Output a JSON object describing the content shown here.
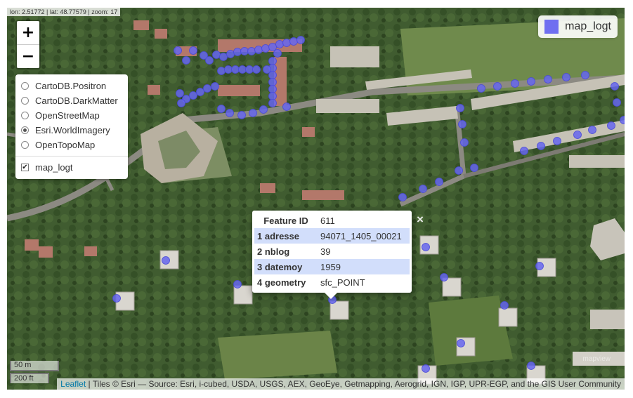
{
  "map": {
    "coord_readout": "lon: 2.51772 | lat: 48.77579 | zoom: 17",
    "zoom_in": "+",
    "zoom_out": "−",
    "basemaps": [
      {
        "label": "CartoDB.Positron",
        "selected": false
      },
      {
        "label": "CartoDB.DarkMatter",
        "selected": false
      },
      {
        "label": "OpenStreetMap",
        "selected": false
      },
      {
        "label": "Esri.WorldImagery",
        "selected": true
      },
      {
        "label": "OpenTopoMap",
        "selected": false
      }
    ],
    "overlay": {
      "label": "map_logt",
      "check": "✔"
    },
    "legend": {
      "label": "map_logt",
      "color": "#6f6ff0"
    },
    "popup": {
      "rows": [
        {
          "key": "Feature ID",
          "value": "611"
        },
        {
          "key": "1 adresse",
          "value": "94071_1405_00021"
        },
        {
          "key": "2 nblog",
          "value": "39"
        },
        {
          "key": "3 datemoy",
          "value": "1959"
        },
        {
          "key": "4 geometry",
          "value": "sfc_POINT"
        }
      ],
      "close": "×"
    },
    "scale": {
      "metric": "50 m",
      "imperial": "200 ft"
    },
    "attribution": {
      "link": "Leaflet",
      "text": " | Tiles © Esri — Source: Esri, i-cubed, USDA, USGS, AEX, GeoEye, Getmapping, Aerogrid, IGN, IGP, UPR-EGP, and the GIS User Community"
    },
    "watermark": "mapview",
    "marker_color": "#6666ee",
    "imagery_colors": {
      "vegetation": "#3f5a2f",
      "roof": "#b8b2a6",
      "road": "#8a8a84"
    }
  }
}
